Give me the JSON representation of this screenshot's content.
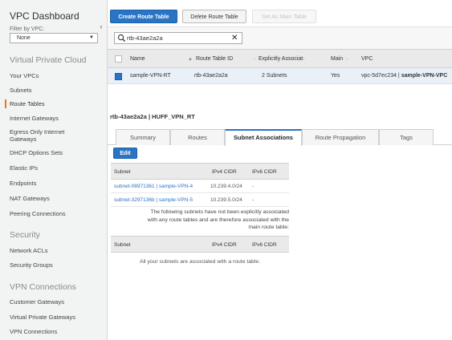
{
  "sidebar": {
    "title": "VPC Dashboard",
    "filter_label": "Filter by VPC:",
    "filter_value": "None",
    "collapse_glyph": "‹",
    "sections": {
      "vpc": "Virtual Private Cloud",
      "security": "Security",
      "vpn": "VPN Connections"
    },
    "items": [
      {
        "label": "Your VPCs"
      },
      {
        "label": "Subnets"
      },
      {
        "label": "Route Tables"
      },
      {
        "label": "Internet Gateways"
      },
      {
        "label": "Egress Only Internet"
      },
      {
        "label": "Gateways"
      },
      {
        "label": "DHCP Options Sets"
      },
      {
        "label": "Elastic IPs"
      },
      {
        "label": "Endpoints"
      },
      {
        "label": "NAT Gateways"
      },
      {
        "label": "Peering Connections"
      },
      {
        "label": "Network ACLs"
      },
      {
        "label": "Security Groups"
      },
      {
        "label": "Customer Gateways"
      },
      {
        "label": "Virtual Private Gateways"
      },
      {
        "label": "VPN Connections"
      }
    ],
    "active_item": "Route Tables",
    "accent_color": "#e47911"
  },
  "toolbar": {
    "create_label": "Create Route Table",
    "delete_label": "Delete Route Table",
    "set_main_label": "Set As Main Table"
  },
  "search": {
    "value": "rtb-43ae2a2a",
    "clear_glyph": "✕"
  },
  "table": {
    "columns": {
      "name": "Name",
      "route_table_id": "Route Table ID",
      "explicit": "Explicitly Associat·",
      "main": "Main",
      "vpc": "VPC"
    },
    "rows": [
      {
        "name": "sample-VPN-RT",
        "route_table_id": "rtb-43ae2a2a",
        "explicit": "2 Subnets",
        "main": "Yes",
        "vpc_id": "vpc-5d7ec234 |",
        "vpc_name": "sample-VPN-VPC"
      }
    ]
  },
  "details": {
    "title": "rtb-43ae2a2a | HUFF_VPN_RT",
    "tabs": [
      {
        "label": "Summary"
      },
      {
        "label": "Routes"
      },
      {
        "label": "Subnet Associations"
      },
      {
        "label": "Route Propagation"
      },
      {
        "label": "Tags"
      }
    ],
    "active_tab": "Subnet Associations",
    "edit_label": "Edit",
    "assoc_columns": {
      "subnet": "Subnet",
      "ipv4": "IPv4 CIDR",
      "ipv6": "IPv6 CIDR"
    },
    "assoc_rows": [
      {
        "subnet": "subnet-08971361 | sample-VPN-4",
        "ipv4": "10.239.4.0/24",
        "ipv6": "-"
      },
      {
        "subnet": "subnet-3297136b | sample-VPN-5",
        "ipv4": "10.239.5.0/24",
        "ipv6": "-"
      }
    ],
    "notice_lines": [
      "The following subnets have not been explicitly associated",
      "with any route tables and are therefore associated with the",
      "main route table:"
    ],
    "unassoc_columns": {
      "subnet": "Subnet",
      "ipv4": "IPv4 CIDR",
      "ipv6": "IPv6 CIDR"
    },
    "unassoc_empty": "All your subnets are associated with a route table."
  },
  "colors": {
    "primary": "#2a74c5",
    "selected_row": "#eaf0f8",
    "header_bg": "#eaeaea"
  }
}
